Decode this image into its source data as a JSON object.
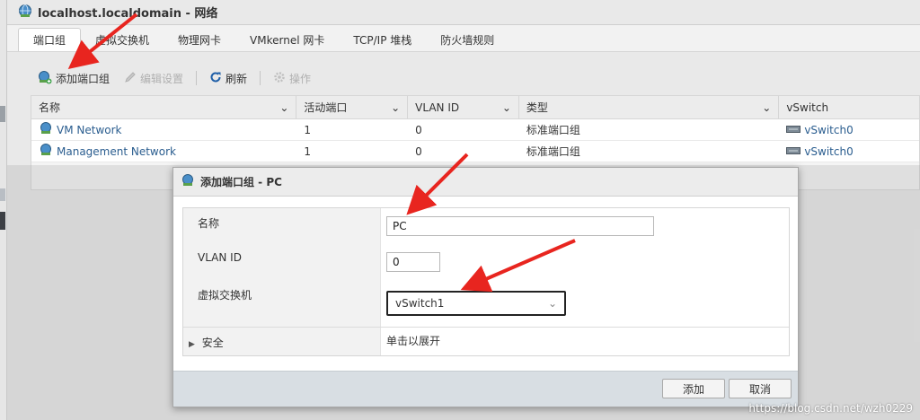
{
  "window": {
    "title": "localhost.localdomain - 网络"
  },
  "tabs": [
    {
      "label": "端口组",
      "active": true
    },
    {
      "label": "虚拟交换机",
      "active": false
    },
    {
      "label": "物理网卡",
      "active": false
    },
    {
      "label": "VMkernel 网卡",
      "active": false
    },
    {
      "label": "TCP/IP 堆栈",
      "active": false
    },
    {
      "label": "防火墙规则",
      "active": false
    }
  ],
  "toolbar": {
    "add_port_group": "添加端口组",
    "edit_settings": "编辑设置",
    "refresh": "刷新",
    "actions": "操作"
  },
  "table": {
    "columns": [
      "名称",
      "活动端口",
      "VLAN ID",
      "类型",
      "vSwitch"
    ],
    "rows": [
      {
        "name": "VM Network",
        "active_ports": "1",
        "vlan": "0",
        "type": "标准端口组",
        "vswitch": "vSwitch0"
      },
      {
        "name": "Management Network",
        "active_ports": "1",
        "vlan": "0",
        "type": "标准端口组",
        "vswitch": "vSwitch0"
      }
    ]
  },
  "dialog": {
    "title": "添加端口组 - PC",
    "fields": {
      "name_label": "名称",
      "name_value": "PC",
      "vlan_label": "VLAN ID",
      "vlan_value": "0",
      "vswitch_label": "虚拟交换机",
      "vswitch_value": "vSwitch1",
      "security_label": "安全",
      "security_value": "单击以展开"
    },
    "buttons": {
      "add": "添加",
      "cancel": "取消"
    }
  },
  "watermark": "https://blog.csdn.net/wzh0229",
  "colors": {
    "annotation_arrow": "#e8251f",
    "link": "#2a5d8f"
  }
}
